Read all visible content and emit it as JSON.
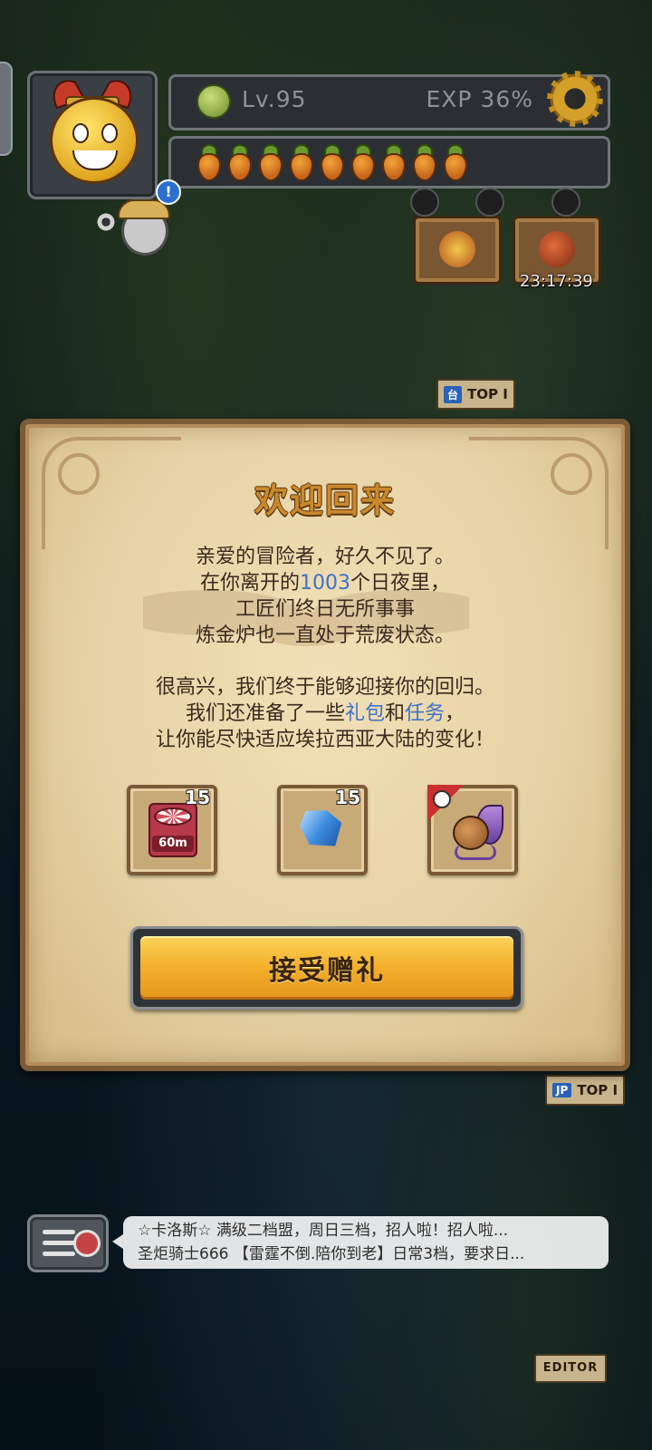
{
  "hud": {
    "level": "Lv.95",
    "exp": "EXP 36%",
    "energy_count": 9,
    "timer": "23:17:39"
  },
  "map_flags": [
    {
      "tag": "台",
      "label": "TOP I"
    },
    {
      "tag": "JP",
      "label": "TOP I"
    }
  ],
  "editor_label": "EDITOR",
  "dialog": {
    "title": "欢迎回来",
    "para1": {
      "line1": "亲爱的冒险者，好久不见了。",
      "line2_pre": "在你离开的",
      "line2_days": "1003",
      "line2_post": "个日夜里，",
      "line3": "工匠们终日无所事事",
      "line4": "炼金炉也一直处于荒废状态。"
    },
    "para2": {
      "line1": "很高兴，我们终于能够迎接你的回归。",
      "line2_pre": "我们还准备了一些",
      "line2_gift": "礼包",
      "line2_and": "和",
      "line2_task": "任务",
      "line2_post": "，",
      "line3": "让你能尽快适应埃拉西亚大陆的变化！"
    },
    "rewards": [
      {
        "name": "time-booster",
        "count": "15",
        "badge": "60m"
      },
      {
        "name": "blue-crystal",
        "count": "15"
      },
      {
        "name": "pet-companion",
        "count": ""
      }
    ],
    "accept_button": "接受赠礼"
  },
  "chat": {
    "line1": "☆卡洛斯☆  满级二档盟，周日三档，招人啦！招人啦...",
    "line2": "圣炬骑士666 【雷霆不倒.陪你到老】日常3档，要求日..."
  },
  "colors": {
    "title_gold": "#c98a2c",
    "highlight_blue": "#3f72c9",
    "button_gold": "#f4b22d"
  }
}
